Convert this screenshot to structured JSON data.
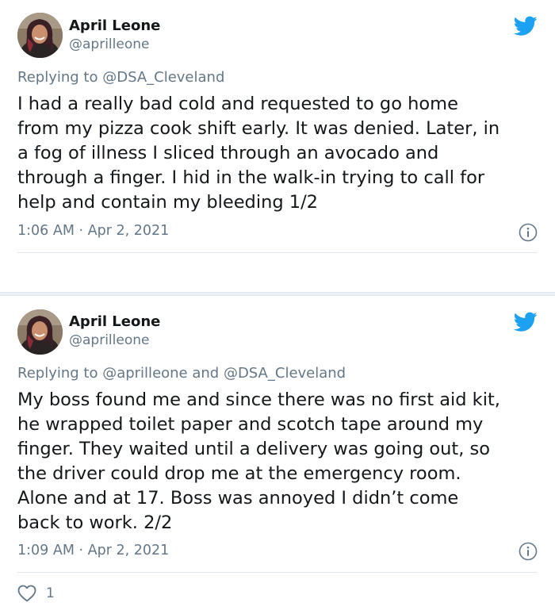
{
  "tweets": [
    {
      "author_name": "April Leone",
      "author_handle": "@aprilleone",
      "reply_prefix": "Replying to ",
      "reply_targets": "@DSA_Cleveland",
      "text_lines": [
        "I had a really bad cold and requested to go home",
        "from my pizza cook shift early. It was denied. Later, in",
        "a fog of illness I sliced through an avocado and",
        "through a finger. I hid in the walk-in trying to call for",
        "help and contain my bleeding 1/2"
      ],
      "timestamp": "1:06 AM · Apr 2, 2021"
    },
    {
      "author_name": "April Leone",
      "author_handle": "@aprilleone",
      "reply_prefix": "Replying to ",
      "reply_targets": "@aprilleone and @DSA_Cleveland",
      "text_lines": [
        "My boss found me and since there was no first aid kit,",
        "he wrapped toilet paper and scotch tape around my",
        "finger. They waited until a delivery was going out, so",
        "the driver could drop me at the emergency room.",
        "Alone and at 17. Boss was annoyed I didn’t come",
        "back to work. 2/2"
      ],
      "timestamp": "1:09 AM · Apr 2, 2021",
      "like_count": "1"
    }
  ],
  "icons": {
    "brand": "twitter-bird-icon",
    "info": "info-icon",
    "like": "heart-icon"
  },
  "colors": {
    "twitter_blue": "#1da1f2",
    "secondary_text": "#657786",
    "primary_text": "#14171a",
    "divider": "#e1e8ed"
  }
}
